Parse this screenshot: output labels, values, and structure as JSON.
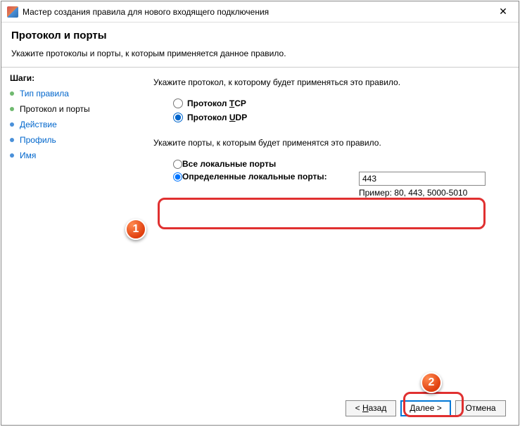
{
  "titlebar": {
    "title": "Мастер создания правила для нового входящего подключения"
  },
  "header": {
    "title": "Протокол и порты",
    "description": "Укажите протоколы и порты, к которым применяется данное правило."
  },
  "steps": {
    "title": "Шаги:",
    "items": [
      {
        "label": "Тип правила",
        "state": "done"
      },
      {
        "label": "Протокол и порты",
        "state": "current"
      },
      {
        "label": "Действие",
        "state": "future"
      },
      {
        "label": "Профиль",
        "state": "future"
      },
      {
        "label": "Имя",
        "state": "future"
      }
    ]
  },
  "main": {
    "protocol_prompt": "Укажите протокол, к которому будет применяться это правило.",
    "protocol_tcp_prefix": "Протокол ",
    "protocol_tcp_hot": "T",
    "protocol_tcp_suffix": "CP",
    "protocol_udp_prefix": "Протокол ",
    "protocol_udp_hot": "U",
    "protocol_udp_suffix": "DP",
    "ports_prompt": "Укажите порты, к которым будет применятся это правило.",
    "all_ports": "Все локальные порты",
    "specific_ports": "Определенные локальные порты:",
    "port_value": "443",
    "port_example": "Пример: 80, 443, 5000-5010"
  },
  "footer": {
    "back": "Назад",
    "next": "Далее",
    "cancel": "Отмена"
  },
  "annotations": {
    "badge1": "1",
    "badge2": "2"
  }
}
